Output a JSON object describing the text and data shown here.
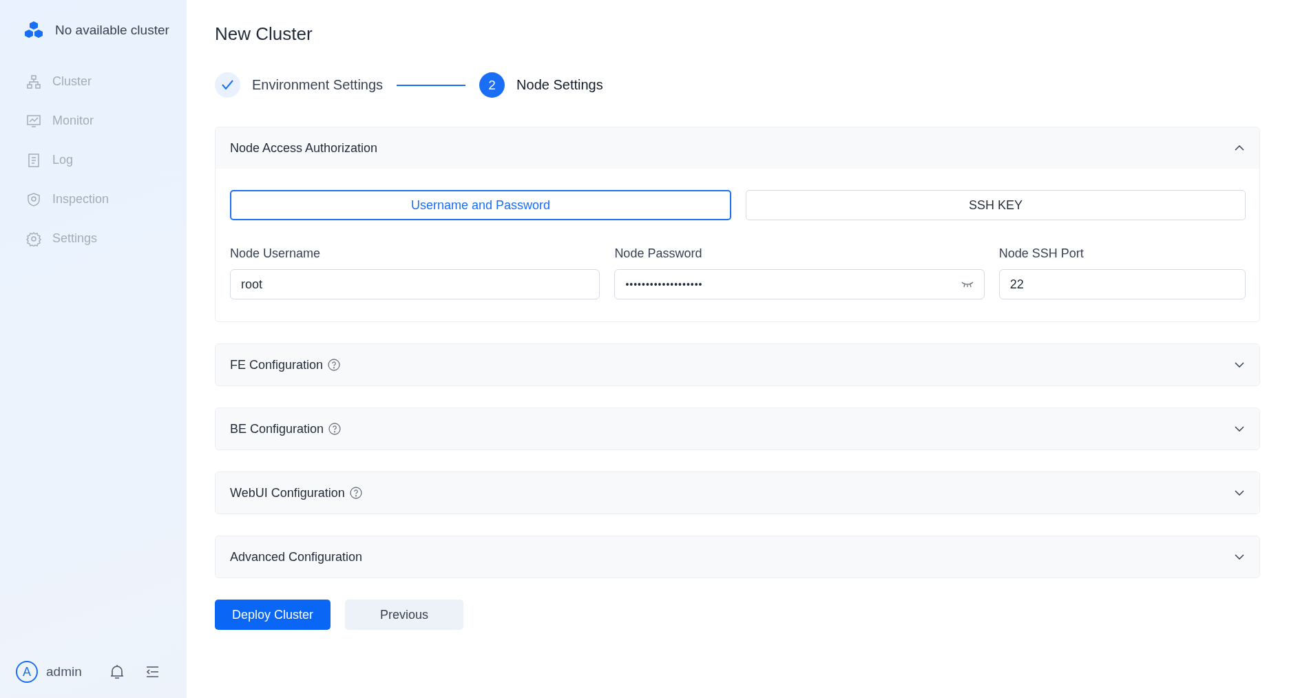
{
  "sidebar": {
    "cluster_name": "No available cluster",
    "items": [
      {
        "label": "Cluster",
        "disabled": true
      },
      {
        "label": "Monitor",
        "disabled": true
      },
      {
        "label": "Log",
        "disabled": true
      },
      {
        "label": "Inspection",
        "disabled": true
      },
      {
        "label": "Settings",
        "disabled": true
      }
    ],
    "user": {
      "initial": "A",
      "name": "admin"
    }
  },
  "page_title": "New Cluster",
  "steps": [
    {
      "label": "Environment Settings",
      "done": true
    },
    {
      "label": "Node Settings",
      "done": false,
      "number": "2"
    }
  ],
  "sections": [
    {
      "title": "Node Access Authorization",
      "help": false,
      "expanded": true,
      "auth_methods": [
        {
          "label": "Username and Password",
          "selected": true
        },
        {
          "label": "SSH KEY",
          "selected": false
        }
      ],
      "fields": [
        {
          "label": "Node Username",
          "value": "root",
          "kind": "text"
        },
        {
          "label": "Node Password",
          "value": "•••••••••••••••••••",
          "kind": "password"
        },
        {
          "label": "Node SSH Port",
          "value": "22",
          "kind": "text"
        }
      ]
    },
    {
      "title": "FE Configuration",
      "help": true,
      "expanded": false
    },
    {
      "title": "BE Configuration",
      "help": true,
      "expanded": false
    },
    {
      "title": "WebUI Configuration",
      "help": true,
      "expanded": false
    },
    {
      "title": "Advanced Configuration",
      "help": false,
      "expanded": false
    }
  ],
  "buttons": [
    {
      "label": "Deploy Cluster",
      "kind": "primary"
    },
    {
      "label": "Previous",
      "kind": "secondary"
    }
  ]
}
